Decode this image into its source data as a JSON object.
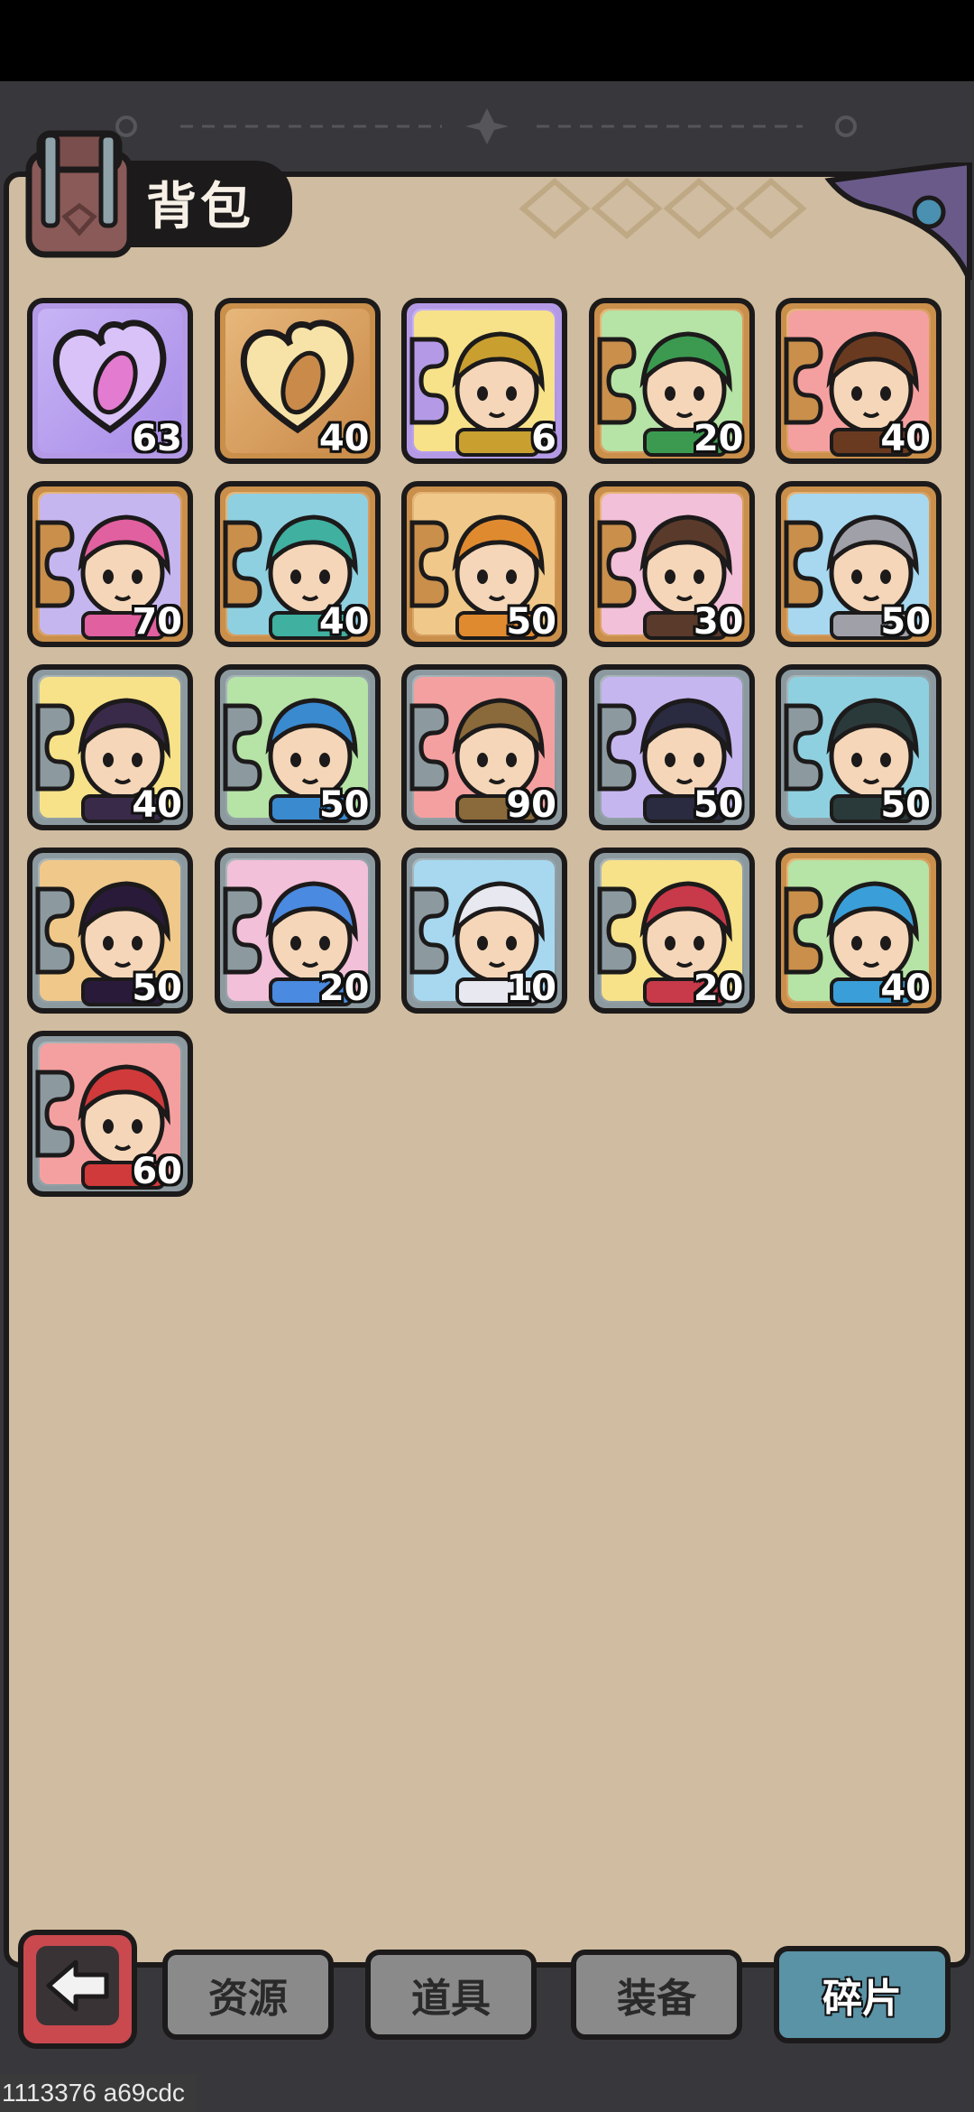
{
  "header": {
    "title": "背包"
  },
  "items": [
    {
      "count": "63",
      "frame": "purple",
      "kind": "purple-heart-crystal-icon"
    },
    {
      "count": "40",
      "frame": "gold",
      "kind": "gold-heart-crystal-icon"
    },
    {
      "count": "6",
      "frame": "purple",
      "kind": "hero-shard-blue-hair-archer"
    },
    {
      "count": "20",
      "frame": "gold",
      "kind": "hero-shard-red-hair-monocle"
    },
    {
      "count": "40",
      "frame": "gold",
      "kind": "hero-shard-gold-helmet-knight"
    },
    {
      "count": "70",
      "frame": "gold",
      "kind": "hero-shard-green-hair-warrior"
    },
    {
      "count": "40",
      "frame": "gold",
      "kind": "hero-shard-braided-fighter"
    },
    {
      "count": "50",
      "frame": "gold",
      "kind": "hero-shard-pink-hair-gunner"
    },
    {
      "count": "30",
      "frame": "gold",
      "kind": "hero-shard-green-crown-mage"
    },
    {
      "count": "50",
      "frame": "gold",
      "kind": "hero-shard-bearded-warrior"
    },
    {
      "count": "40",
      "frame": "silver",
      "kind": "hero-shard-bearded-brawler"
    },
    {
      "count": "50",
      "frame": "silver",
      "kind": "hero-shard-iron-helmet-knight"
    },
    {
      "count": "90",
      "frame": "silver",
      "kind": "hero-shard-dark-beard-shaman"
    },
    {
      "count": "50",
      "frame": "silver",
      "kind": "hero-shard-blue-dragon"
    },
    {
      "count": "50",
      "frame": "silver",
      "kind": "hero-shard-wood-golem"
    },
    {
      "count": "50",
      "frame": "silver",
      "kind": "hero-shard-purple-hair-assassin"
    },
    {
      "count": "20",
      "frame": "silver",
      "kind": "hero-shard-dark-hair-swordsman"
    },
    {
      "count": "10",
      "frame": "silver",
      "kind": "hero-shard-purple-ponytail-fighter"
    },
    {
      "count": "20",
      "frame": "silver",
      "kind": "hero-shard-blue-braid-girl"
    },
    {
      "count": "40",
      "frame": "gold",
      "kind": "hero-shard-white-hair-goggles"
    },
    {
      "count": "60",
      "frame": "silver",
      "kind": "hero-shard-red-hair-princess"
    }
  ],
  "tabs": [
    {
      "label": "资源",
      "active": false
    },
    {
      "label": "道具",
      "active": false
    },
    {
      "label": "装备",
      "active": false
    },
    {
      "label": "碎片",
      "active": true
    }
  ],
  "footer": {
    "build_id": "1113376 a69cdc"
  },
  "colors": {
    "panel": "#d0bca0",
    "gold_frame": "#c98f4b",
    "purple_frame": "#b49ae6",
    "silver_frame": "#8c9aa0",
    "active_tab": "#5a92a6"
  }
}
